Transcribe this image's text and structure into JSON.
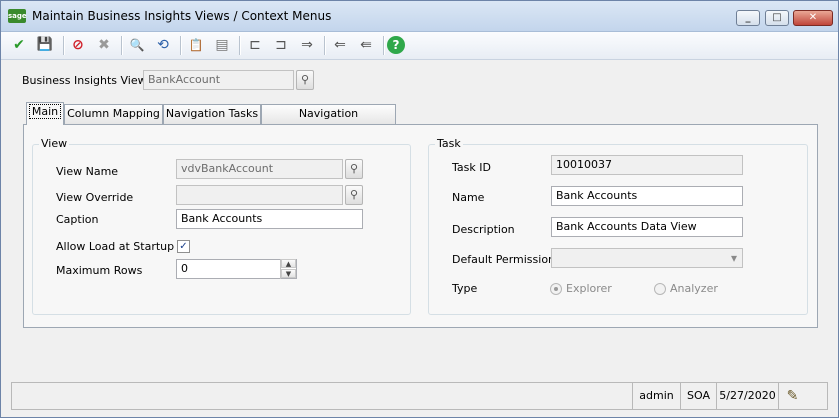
{
  "window": {
    "title": "Maintain Business Insights Views / Context Menus",
    "app_icon_text": "sage",
    "minimize": "_",
    "maximize": "□",
    "close": "✕"
  },
  "toolbar": {
    "icons": [
      "accept-icon",
      "save-icon",
      "delete-icon",
      "cancel-icon",
      "lookup-icon",
      "refresh-icon",
      "copy-icon",
      "list-icon",
      "column-mapping-icon",
      "navigation-tasks-icon",
      "navigation-relationships-icon",
      "move-left-icon",
      "move-left-alt-icon",
      "help-icon"
    ],
    "glyphs": {
      "accept": "✔",
      "save": "💾",
      "delete": "⊘",
      "cancel": "✖",
      "lookup": "🔍",
      "refresh": "⟲",
      "copy": "📋",
      "list": "▤",
      "colmap": "⊏",
      "navtasks": "⊐",
      "navrel": "⇒",
      "moveleft": "⇐",
      "moveleft2": "⇚",
      "help": "?"
    }
  },
  "header": {
    "bi_view_label": "Business Insights View",
    "bi_view_value": "BankAccount"
  },
  "tabs": [
    {
      "label": "Main",
      "active": true
    },
    {
      "label": "Column Mapping",
      "active": false
    },
    {
      "label": "Navigation Tasks",
      "active": false
    },
    {
      "label": "Navigation Relationships",
      "active": false
    }
  ],
  "view": {
    "group_title": "View",
    "view_name_label": "View Name",
    "view_name_value": "vdvBankAccount",
    "view_override_label": "View Override",
    "view_override_value": "",
    "caption_label": "Caption",
    "caption_value": "Bank Accounts",
    "allow_load_label": "Allow Load at Startup",
    "allow_load_checked": "✓",
    "max_rows_label": "Maximum Rows",
    "max_rows_value": "0",
    "spin_up": "▲",
    "spin_down": "▼"
  },
  "task": {
    "group_title": "Task",
    "task_id_label": "Task ID",
    "task_id_value": "10010037",
    "name_label": "Name",
    "name_value": "Bank Accounts",
    "description_label": "Description",
    "description_value": "Bank Accounts Data View",
    "default_permission_label": "Default Permission",
    "default_permission_value": "",
    "dropdown_arrow": "▾",
    "type_label": "Type",
    "type_options": [
      {
        "label": "Explorer",
        "selected": true
      },
      {
        "label": "Analyzer",
        "selected": false
      }
    ]
  },
  "statusbar": {
    "user": "admin",
    "company": "SOA",
    "date": "5/27/2020",
    "notes_glyph": "✎"
  }
}
